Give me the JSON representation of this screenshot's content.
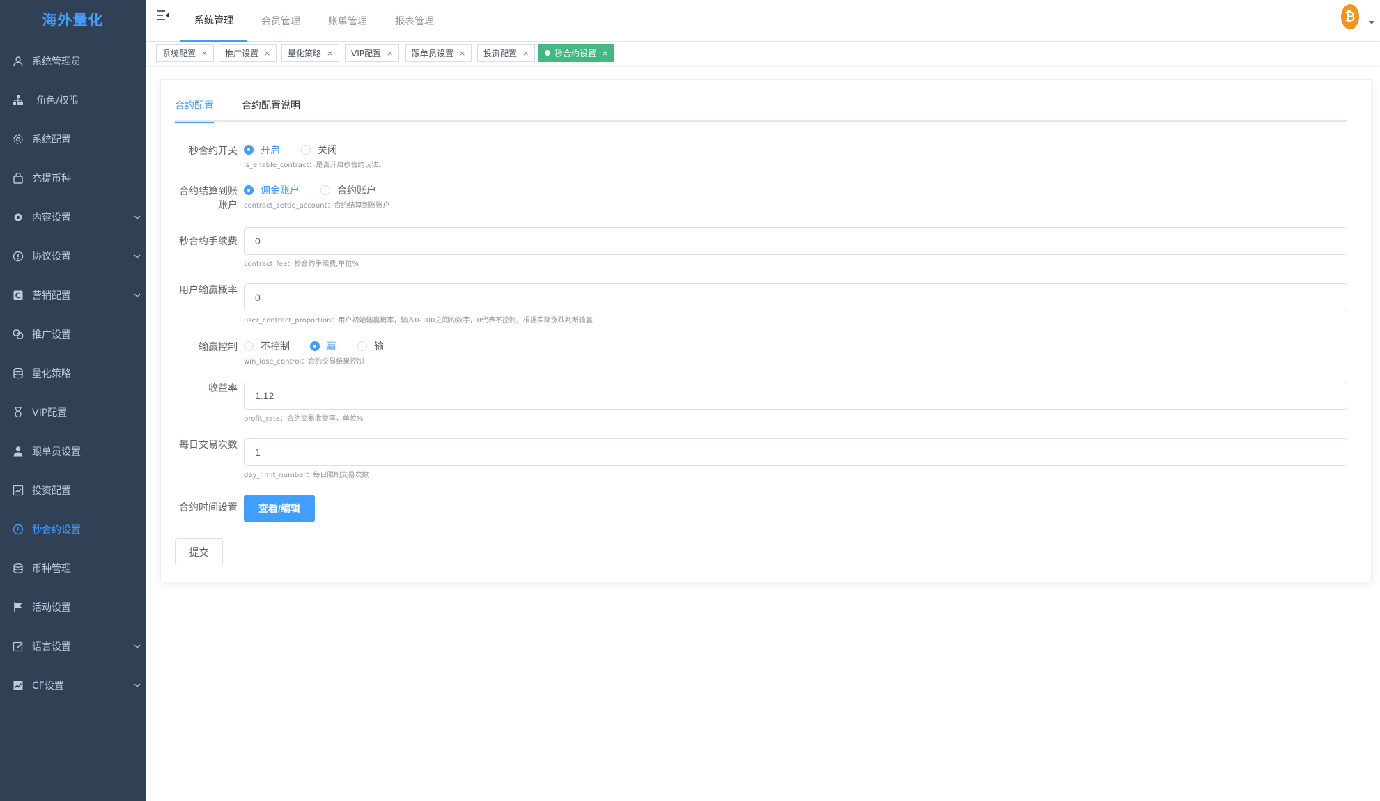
{
  "app": {
    "logo_text": "海外量化"
  },
  "sidebar": {
    "items": [
      {
        "label": "系统管理员",
        "icon": "user-icon"
      },
      {
        "label": "角色/权限",
        "icon": "sitemap-icon"
      },
      {
        "label": "系统配置",
        "icon": "gear-icon"
      },
      {
        "label": "充提币种",
        "icon": "bag-icon"
      },
      {
        "label": "内容设置",
        "icon": "cog-icon",
        "expandable": true
      },
      {
        "label": "协议设置",
        "icon": "info-circle-icon",
        "expandable": true
      },
      {
        "label": "营销配置",
        "icon": "chart-icon",
        "expandable": true
      },
      {
        "label": "推广设置",
        "icon": "link-icon"
      },
      {
        "label": "量化策略",
        "icon": "database-icon"
      },
      {
        "label": "VIP配置",
        "icon": "medal-icon"
      },
      {
        "label": "跟单员设置",
        "icon": "person-icon"
      },
      {
        "label": "投资配置",
        "icon": "dashboard-icon"
      },
      {
        "label": "秒合约设置",
        "icon": "clock-icon",
        "active": true
      },
      {
        "label": "币种管理",
        "icon": "coins-icon"
      },
      {
        "label": "活动设置",
        "icon": "flag-icon"
      },
      {
        "label": "语言设置",
        "icon": "edit-icon",
        "expandable": true
      },
      {
        "label": "CF设置",
        "icon": "trend-icon",
        "expandable": true
      }
    ]
  },
  "header": {
    "tabs": [
      {
        "label": "系统管理",
        "active": true
      },
      {
        "label": "会员管理"
      },
      {
        "label": "账单管理"
      },
      {
        "label": "报表管理"
      }
    ],
    "avatar_symbol": "₿"
  },
  "tags": [
    {
      "label": "系统配置"
    },
    {
      "label": "推广设置"
    },
    {
      "label": "量化策略"
    },
    {
      "label": "VIP配置"
    },
    {
      "label": "跟单员设置"
    },
    {
      "label": "投资配置"
    },
    {
      "label": "秒合约设置",
      "active": true
    }
  ],
  "tag_close": "×",
  "content_tabs": [
    {
      "label": "合约配置",
      "active": true
    },
    {
      "label": "合约配置说明"
    }
  ],
  "form": {
    "enable": {
      "label": "秒合约开关",
      "options": [
        "开启",
        "关闭"
      ],
      "selected": "开启",
      "hint": "is_enable_contract：是否开启秒合约玩法。"
    },
    "settle": {
      "label_line1": "合约结算到账",
      "label_line2": "账户",
      "options": [
        "佣金账户",
        "合约账户"
      ],
      "selected": "佣金账户",
      "hint": "contract_settle_account：合约结算到账账户"
    },
    "fee": {
      "label": "秒合约手续费",
      "value": "0",
      "hint": "contract_fee：秒合约手续费,单位%"
    },
    "proportion": {
      "label": "用户输赢概率",
      "value": "0",
      "hint": "user_contract_proportion：用户初始输赢概率，输入0-100之间的数字，0代表不控制，根据实际涨跌判断输赢"
    },
    "win_lose": {
      "label": "输赢控制",
      "options": [
        "不控制",
        "赢",
        "输"
      ],
      "selected": "赢",
      "hint": "win_lose_control：合约交易结果控制"
    },
    "profit": {
      "label": "收益率",
      "value": "1.12",
      "hint": "profit_rate：合约交易收益率，单位%"
    },
    "day_limit": {
      "label": "每日交易次数",
      "value": "1",
      "hint": "day_limit_number：每日限制交易次数"
    },
    "time": {
      "label": "合约时间设置",
      "button": "查看/编辑"
    },
    "submit": "提交"
  },
  "colors": {
    "sidebar_bg": "#304156",
    "accent": "#409eff",
    "active_tag": "#42b983",
    "btc": "#f7931a"
  }
}
